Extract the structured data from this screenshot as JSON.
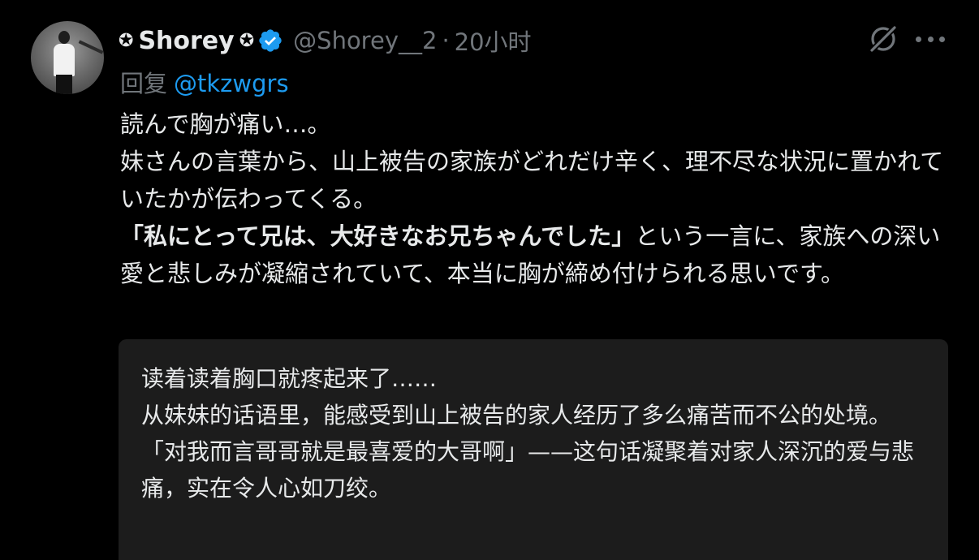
{
  "author": {
    "star_prefix": "✪",
    "name": "Shorey",
    "star_suffix": "✪",
    "handle": "@Shorey__2",
    "separator": "·",
    "time": "20小时"
  },
  "reply": {
    "label": "回复",
    "mention": "@tkzwgrs"
  },
  "tweet": {
    "line1": "読んで胸が痛い…。",
    "line2": "妹さんの言葉から、山上被告の家族がどれだけ辛く、理不尽な状況に置かれていたかが伝わってくる。",
    "quote_bold": "「私にとって兄は、大好きなお兄ちゃんでした」",
    "line3_rest": "という一言に、家族への深い愛と悲しみが凝縮されていて、本当に胸が締め付けられる思いです。"
  },
  "translation": {
    "line1": "读着读着胸口就疼起来了……",
    "line2": "从妹妹的话语里，能感受到山上被告的家人经历了多么痛苦而不公的处境。",
    "line3": "「对我而言哥哥就是最喜爱的大哥啊」——这句话凝聚着对家人深沉的爱与悲痛，实在令人心如刀绞。"
  },
  "icons": {
    "verified": "verified-badge-icon",
    "grok": "grok-icon",
    "more": "more-options-icon"
  },
  "colors": {
    "background": "#000000",
    "text": "#e7e9ea",
    "muted": "#71767b",
    "link": "#1d9bf0",
    "translation_bg": "#1c1c1c"
  }
}
